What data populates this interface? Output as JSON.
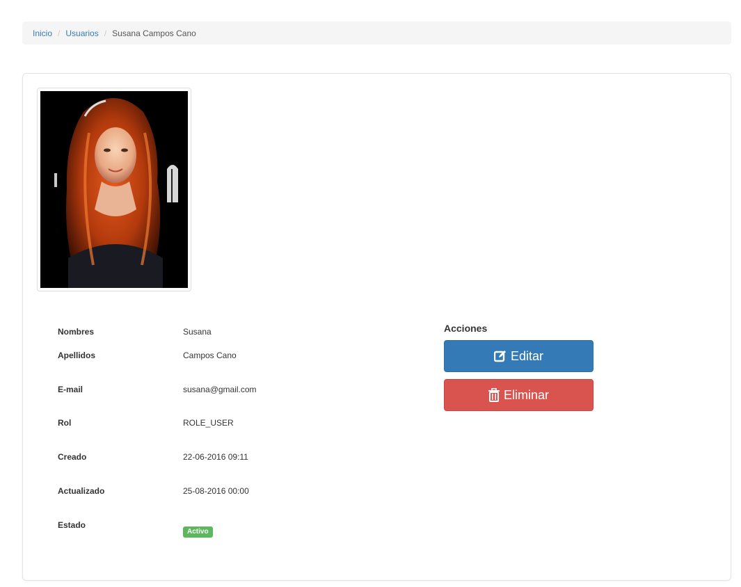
{
  "breadcrumb": {
    "home": "Inicio",
    "users": "Usuarios",
    "current": "Susana Campos Cano",
    "separator": "/"
  },
  "profile": {
    "fields": [
      {
        "label": "Nombres",
        "value": "Susana"
      },
      {
        "label": "Apellidos",
        "value": "Campos Cano"
      },
      {
        "label": "E-mail",
        "value": "susana@gmail.com"
      },
      {
        "label": "Rol",
        "value": "ROLE_USER"
      },
      {
        "label": "Creado",
        "value": "22-06-2016 09:11"
      },
      {
        "label": "Actualizado",
        "value": "25-08-2016 00:00"
      },
      {
        "label": "Estado",
        "badge": "Activo"
      }
    ]
  },
  "actions": {
    "title": "Acciones",
    "edit_label": "Editar",
    "edit_icon": "edit-icon",
    "delete_label": "Eliminar",
    "delete_icon": "trash-icon"
  },
  "colors": {
    "link": "#337ab7",
    "primary": "#337ab7",
    "danger": "#d9534f",
    "success": "#5cb85c"
  }
}
